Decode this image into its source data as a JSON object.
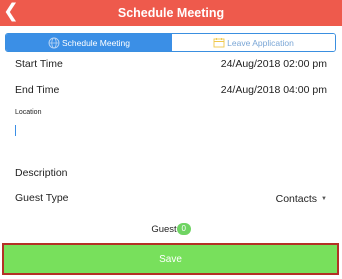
{
  "header": {
    "title": "Schedule Meeting",
    "back_icon": "chevron-left-icon"
  },
  "tabs": [
    {
      "label": "Schedule Meeting",
      "icon": "globe-icon",
      "active": true
    },
    {
      "label": "Leave Application",
      "icon": "calendar-icon",
      "active": false
    }
  ],
  "form": {
    "start_label": "Start Time",
    "start_value": "24/Aug/2018 02:00 pm",
    "end_label": "End Time",
    "end_value": "24/Aug/2018 04:00 pm",
    "location_label": "Location",
    "location_value": "",
    "description_label": "Description",
    "guest_type_label": "Guest Type",
    "guest_type_value": "Contacts"
  },
  "guest": {
    "label": "Guest",
    "count": "0"
  },
  "save_label": "Save",
  "colors": {
    "header": "#ee5a4c",
    "accent": "#3b8fe6",
    "save": "#78e05c",
    "badge": "#6fd463"
  }
}
